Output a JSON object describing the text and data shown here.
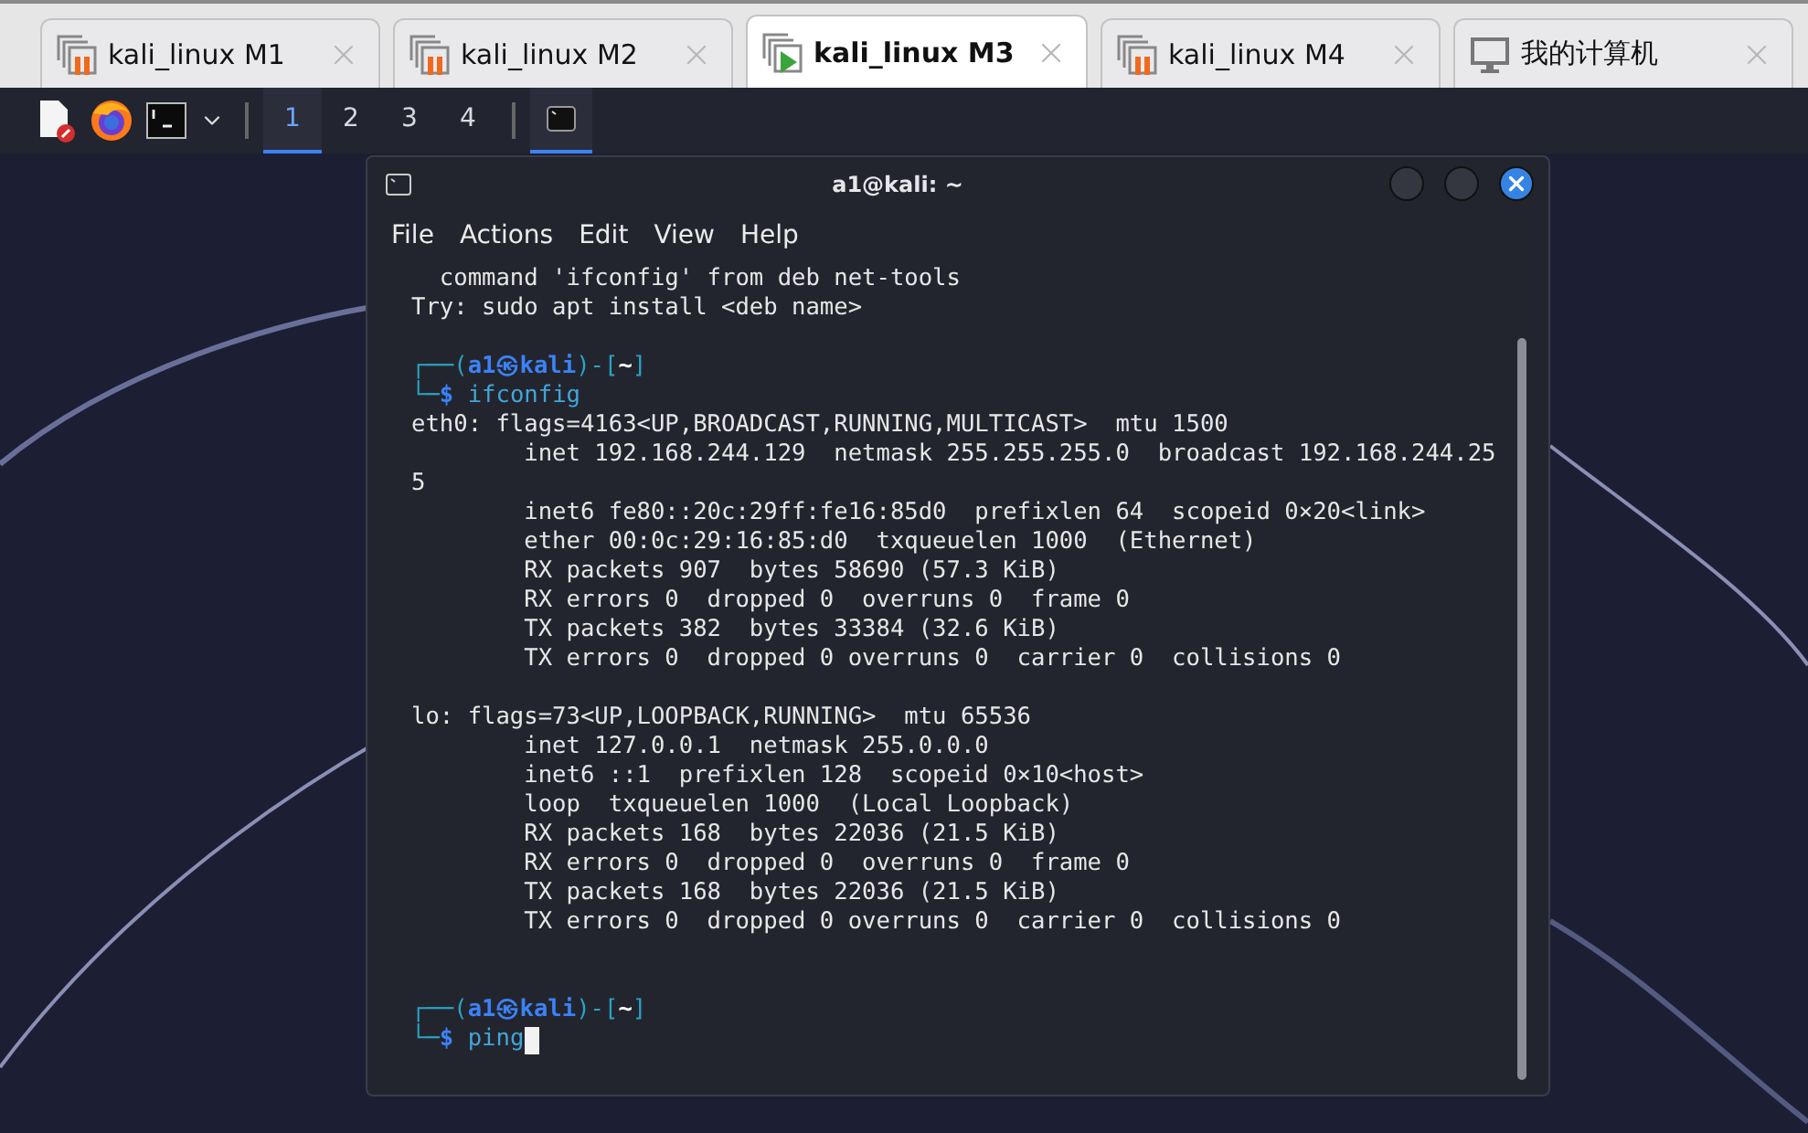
{
  "tabs": [
    {
      "label": "kali_linux M1",
      "kind": "paused",
      "selected": false
    },
    {
      "label": "kali_linux M2",
      "kind": "paused",
      "selected": false
    },
    {
      "label": "kali_linux M3",
      "kind": "running",
      "selected": true
    },
    {
      "label": "kali_linux M4",
      "kind": "paused",
      "selected": false
    },
    {
      "label": "我的计算机",
      "kind": "computer",
      "selected": false
    }
  ],
  "taskbar": {
    "workspaces": [
      {
        "label": "1",
        "selected": true
      },
      {
        "label": "2",
        "selected": false
      },
      {
        "label": "3",
        "selected": false
      },
      {
        "label": "4",
        "selected": false
      }
    ],
    "task": {
      "active": true
    }
  },
  "terminal": {
    "title": "a1@kali: ~",
    "menu": [
      "File",
      "Actions",
      "Edit",
      "View",
      "Help"
    ],
    "lines": [
      {
        "kind": "output",
        "text": "  command 'ifconfig' from deb net-tools"
      },
      {
        "kind": "output",
        "text": "Try: sudo apt install <deb name>"
      },
      {
        "kind": "blank"
      },
      {
        "kind": "prompt",
        "segments": [
          {
            "text": "┌──(",
            "kind": "frame"
          },
          {
            "text": "a1㉿kali",
            "kind": "identity"
          },
          {
            "text": ")-[",
            "kind": "frame"
          },
          {
            "text": "~",
            "kind": "path"
          },
          {
            "text": "]",
            "kind": "frame"
          }
        ]
      },
      {
        "kind": "prompt",
        "segments": [
          {
            "text": "└─",
            "kind": "frame"
          },
          {
            "text": "$",
            "kind": "sign"
          },
          {
            "text": " ifconfig",
            "kind": "command"
          }
        ]
      },
      {
        "kind": "output",
        "text": "eth0: flags=4163<UP,BROADCAST,RUNNING,MULTICAST>  mtu 1500"
      },
      {
        "kind": "output",
        "text": "        inet 192.168.244.129  netmask 255.255.255.0  broadcast 192.168.244.25"
      },
      {
        "kind": "output",
        "text": "5"
      },
      {
        "kind": "output",
        "text": "        inet6 fe80::20c:29ff:fe16:85d0  prefixlen 64  scopeid 0×20<link>"
      },
      {
        "kind": "output",
        "text": "        ether 00:0c:29:16:85:d0  txqueuelen 1000  (Ethernet)"
      },
      {
        "kind": "output",
        "text": "        RX packets 907  bytes 58690 (57.3 KiB)"
      },
      {
        "kind": "output",
        "text": "        RX errors 0  dropped 0  overruns 0  frame 0"
      },
      {
        "kind": "output",
        "text": "        TX packets 382  bytes 33384 (32.6 KiB)"
      },
      {
        "kind": "output",
        "text": "        TX errors 0  dropped 0 overruns 0  carrier 0  collisions 0"
      },
      {
        "kind": "blank"
      },
      {
        "kind": "output",
        "text": "lo: flags=73<UP,LOOPBACK,RUNNING>  mtu 65536"
      },
      {
        "kind": "output",
        "text": "        inet 127.0.0.1  netmask 255.0.0.0"
      },
      {
        "kind": "output",
        "text": "        inet6 ::1  prefixlen 128  scopeid 0×10<host>"
      },
      {
        "kind": "output",
        "text": "        loop  txqueuelen 1000  (Local Loopback)"
      },
      {
        "kind": "output",
        "text": "        RX packets 168  bytes 22036 (21.5 KiB)"
      },
      {
        "kind": "output",
        "text": "        RX errors 0  dropped 0  overruns 0  frame 0"
      },
      {
        "kind": "output",
        "text": "        TX packets 168  bytes 22036 (21.5 KiB)"
      },
      {
        "kind": "output",
        "text": "        TX errors 0  dropped 0 overruns 0  carrier 0  collisions 0"
      },
      {
        "kind": "blank"
      },
      {
        "kind": "blank"
      },
      {
        "kind": "prompt",
        "segments": [
          {
            "text": "┌──(",
            "kind": "frame"
          },
          {
            "text": "a1㉿kali",
            "kind": "identity"
          },
          {
            "text": ")-[",
            "kind": "frame"
          },
          {
            "text": "~",
            "kind": "path"
          },
          {
            "text": "]",
            "kind": "frame"
          }
        ]
      },
      {
        "kind": "prompt",
        "cursor": true,
        "segments": [
          {
            "text": "└─",
            "kind": "frame"
          },
          {
            "text": "$",
            "kind": "sign"
          },
          {
            "text": " ping",
            "kind": "command"
          }
        ]
      }
    ]
  }
}
